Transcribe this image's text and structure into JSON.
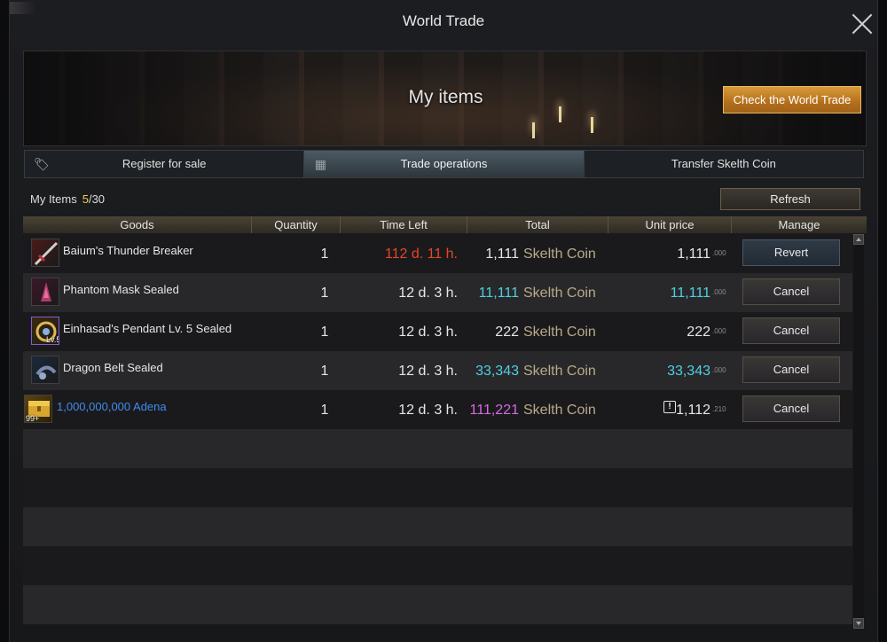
{
  "window": {
    "title": "World Trade"
  },
  "banner": {
    "title": "My items",
    "check_button": "Check the World Trade"
  },
  "tabs": [
    {
      "label": "Register for sale",
      "icon": "tag-icon"
    },
    {
      "label": "Trade operations",
      "icon": "ledger-icon"
    },
    {
      "label": "Transfer Skelth Coin"
    }
  ],
  "summary": {
    "label": "My Items",
    "current": "5",
    "max": "/30"
  },
  "refresh_label": "Refresh",
  "columns": [
    "Goods",
    "Quantity",
    "Time Left",
    "Total",
    "Unit price",
    "Manage"
  ],
  "currency": "Skelth Coin",
  "items": [
    {
      "name": "Baium's Thunder Breaker",
      "quantity": "1",
      "time_left": "112 d. 11 h.",
      "total": "1,111",
      "unit": "1,111",
      "unit_frac": ".000",
      "action": "Revert",
      "icon": "sword-icon"
    },
    {
      "name": "Phantom Mask Sealed",
      "quantity": "1",
      "time_left": "12 d. 3 h.",
      "total": "11,111",
      "unit": "11,111",
      "unit_frac": ".000",
      "action": "Cancel",
      "icon": "mask-icon"
    },
    {
      "name": "Einhasad's Pendant Lv. 5 Sealed",
      "quantity": "1",
      "time_left": "12 d. 3 h.",
      "total": "222",
      "unit": "222",
      "unit_frac": ".000",
      "action": "Cancel",
      "icon": "pendant-icon",
      "badge": "Lv.5"
    },
    {
      "name": "Dragon Belt Sealed",
      "quantity": "1",
      "time_left": "12 d. 3 h.",
      "total": "33,343",
      "unit": "33,343",
      "unit_frac": ".000",
      "action": "Cancel",
      "icon": "belt-icon"
    },
    {
      "name": "1,000,000,000 Adena",
      "quantity": "1",
      "time_left": "12 d. 3 h.",
      "total": "111,221",
      "unit": "1,112",
      "unit_frac": ".210",
      "action": "Cancel",
      "icon": "gold-chest-icon",
      "badge": "99+"
    }
  ],
  "colors": {
    "accent_orange": "#c98224",
    "highlight_cyan": "#4fd0e4",
    "expiry_red": "#e9442a",
    "highlight_pink": "#d868e4",
    "adena_blue": "#3f8cf0"
  }
}
